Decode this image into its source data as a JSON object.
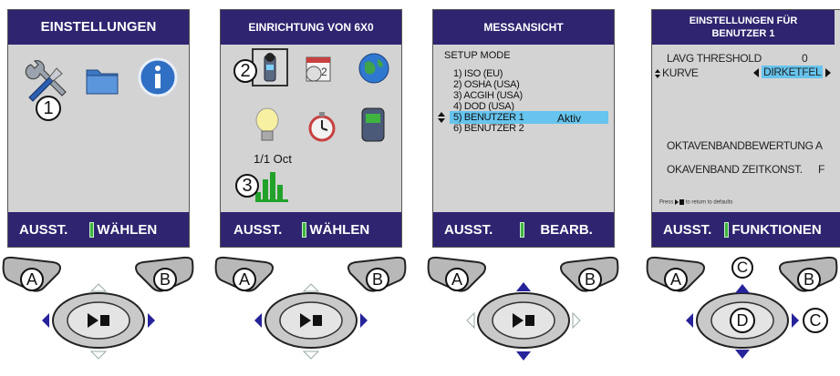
{
  "panels": [
    {
      "title": "EINSTELLUNGEN",
      "footer_left": "AUSST.",
      "footer_right": "WÄHLEN",
      "callouts": [
        "1"
      ],
      "icons": [
        "tools-icon",
        "folder-icon",
        "info-icon"
      ]
    },
    {
      "title": "EINRICHTUNG VON 6X0",
      "footer_left": "AUSST.",
      "footer_right": "WÄHLEN",
      "callouts": [
        "2",
        "3"
      ],
      "octave_label": "1/1 Oct",
      "icons": [
        "meter-icon",
        "calendar-icon",
        "globe-icon",
        "lightbulb-icon",
        "stopwatch-icon",
        "device-icon",
        "octave-bars-icon"
      ]
    },
    {
      "title": "MESSANSICHT",
      "setup_label": "SETUP MODE",
      "items": [
        "1) ISO (EU)",
        "2) OSHA (USA)",
        "3) ACGIH (USA)",
        "4) DOD (USA)",
        "5) BENUTZER 1",
        "6) BENUTZER 2"
      ],
      "selected_index": 4,
      "active_label": "Aktiv",
      "footer_left": "AUSST.",
      "footer_right": "BEARB."
    },
    {
      "title_line1": "EINSTELLUNGEN FÜR",
      "title_line2": "BENUTZER 1",
      "lavg_label": "LAVG THRESHOLD",
      "lavg_value": "0",
      "kurve_label": "KURVE",
      "kurve_value": "DIRKETFEL",
      "oktav_label": "OKTAVENBANDBEWERTUNG A",
      "okav_label": "OKAVENBAND ZEITKONST.",
      "okav_value": "F",
      "press_hint": "Press",
      "press_hint_rest": "to return to defaults",
      "footer_left": "AUSST.",
      "footer_right": "FUNKTIONEN",
      "callouts": [
        "C",
        "D",
        "C"
      ]
    }
  ],
  "controls": {
    "button_a": "A",
    "button_b": "B"
  },
  "colors": {
    "header_bg": "#2e2470",
    "screen_bg": "#d3d3d3",
    "highlight": "#66c4ee",
    "battery": "#3fb53f"
  }
}
